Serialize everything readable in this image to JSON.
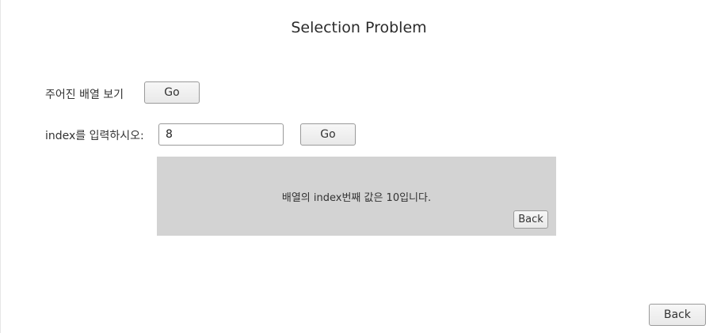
{
  "title": "Selection Problem",
  "array_view": {
    "label": "주어진 배열 보기",
    "go_label": "Go"
  },
  "index_query": {
    "label": "index를 입력하시오:",
    "input_value": "8",
    "go_label": "Go"
  },
  "result": {
    "message": "배열의 index번째 값은 10입니다.",
    "back_label": "Back"
  },
  "footer": {
    "back_label": "Back"
  }
}
